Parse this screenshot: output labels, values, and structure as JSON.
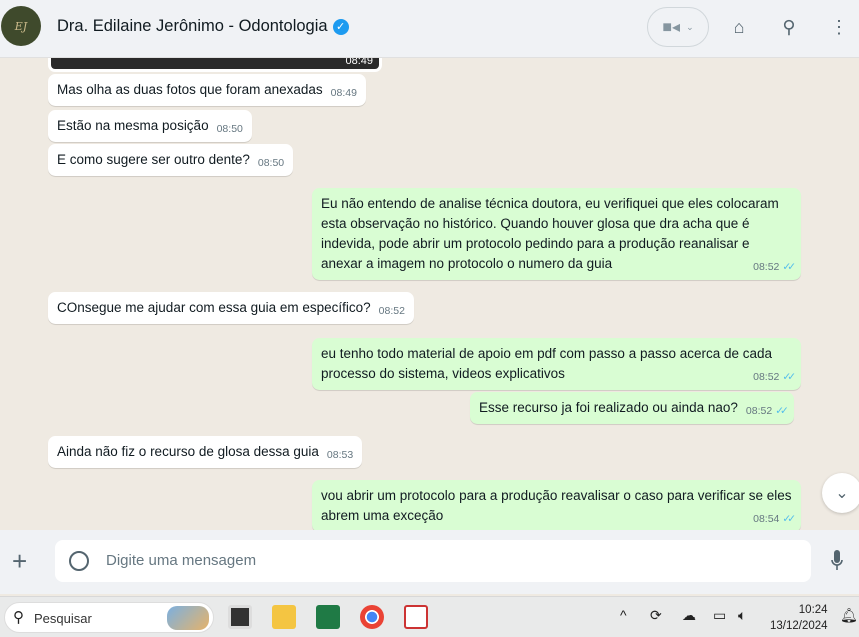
{
  "header": {
    "avatar_text": "EJ",
    "title": "Dra. Edilaine Jerônimo - Odontologia"
  },
  "chat": {
    "image_time": "08:49",
    "messages": [
      {
        "dir": "in",
        "text": "Mas olha as duas fotos que foram anexadas",
        "time": "08:49"
      },
      {
        "dir": "in",
        "text": "Estão na mesma posição",
        "time": "08:50"
      },
      {
        "dir": "in",
        "text": "E como sugere ser outro dente?",
        "time": "08:50"
      },
      {
        "dir": "out",
        "text": "Eu não entendo de analise técnica doutora, eu verifiquei que eles colocaram esta observação no histórico. Quando houver glosa que dra acha que é indevida, pode abrir um protocolo pedindo para a produção reanalisar e anexar a imagem no protocolo o numero da guia",
        "time": "08:52"
      },
      {
        "dir": "in",
        "text": "COnsegue me ajudar com essa guia em específico?",
        "time": "08:52"
      },
      {
        "dir": "out",
        "text": "eu tenho todo material de apoio em pdf com passo a passo acerca de cada processo do sistema, videos explicativos",
        "time": "08:52"
      },
      {
        "dir": "out",
        "text": "Esse recurso ja foi realizado ou ainda nao?",
        "time": "08:52"
      },
      {
        "dir": "in",
        "text": "Ainda não fiz o recurso de glosa dessa guia",
        "time": "08:53"
      },
      {
        "dir": "out",
        "text": "vou abrir um protocolo para a produção reavalisar o caso para verificar se eles abrem uma exceção",
        "time": "08:54"
      }
    ]
  },
  "composer": {
    "placeholder": "Digite uma mensagem"
  },
  "taskbar": {
    "search_label": "Pesquisar",
    "time": "10:24",
    "date": "13/12/2024"
  }
}
